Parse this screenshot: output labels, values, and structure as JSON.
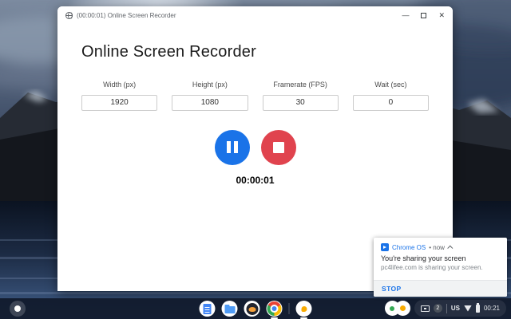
{
  "window": {
    "title": "(00:00:01) Online Screen Recorder",
    "controls": {
      "minimize": "—",
      "close": "✕"
    },
    "heading": "Online Screen Recorder",
    "fields": [
      {
        "label": "Width (px)",
        "value": "1920"
      },
      {
        "label": "Height (px)",
        "value": "1080"
      },
      {
        "label": "Framerate (FPS)",
        "value": "30"
      },
      {
        "label": "Wait (sec)",
        "value": "0"
      }
    ],
    "timer": "00:00:01",
    "colors": {
      "pause_button": "#1a73e8",
      "stop_button": "#e0434e"
    }
  },
  "notification": {
    "app_name": "Chrome OS",
    "meta": "•  now",
    "title": "You're sharing your screen",
    "message": "pc4lifee.com is sharing your screen.",
    "action_label": "STOP",
    "accent": "#1a73e8"
  },
  "shelf": {
    "status": {
      "badge_count": "2",
      "ime": "US",
      "time": "00:21"
    }
  }
}
